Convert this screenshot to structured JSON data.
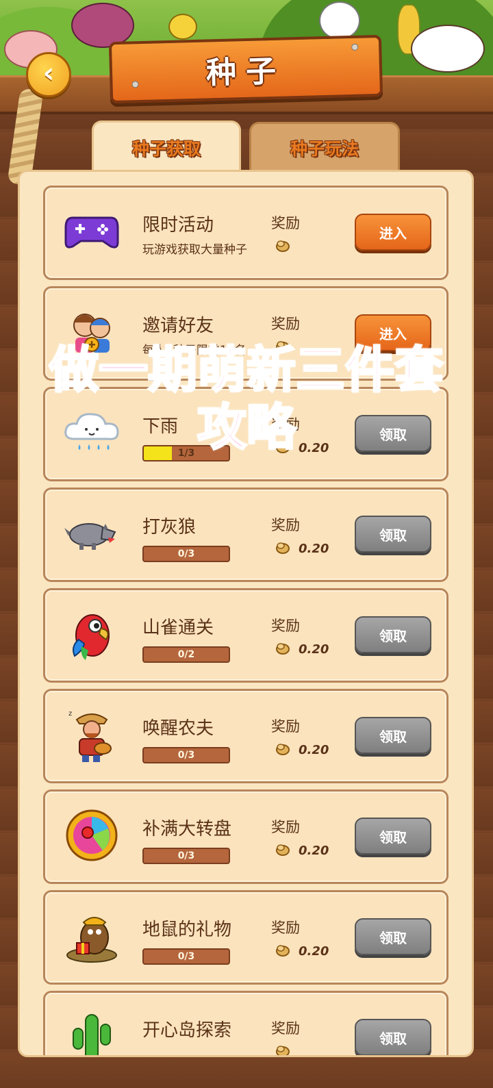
{
  "header": {
    "title": "种子",
    "back_icon": "chevron-left-icon"
  },
  "tabs": [
    {
      "label": "种子获取",
      "active": true
    },
    {
      "label": "种子玩法",
      "active": false
    }
  ],
  "overlay": {
    "line1": "做一期萌新三件套",
    "line2": "攻略"
  },
  "tasks": [
    {
      "name": "限时活动",
      "desc": "玩游戏获取大量种子",
      "reward_label": "奖励",
      "amount": "",
      "progress": "",
      "button": "进入",
      "icon": "gamepad-icon"
    },
    {
      "name": "邀请好友",
      "desc": "每人2种子限前10名",
      "reward_label": "奖励",
      "amount": "",
      "progress": "",
      "button": "进入",
      "icon": "friends-icon"
    },
    {
      "name": "下雨",
      "desc": "",
      "reward_label": "奖励",
      "amount": "0.20",
      "progress": "1/3",
      "progress_value": 0.33,
      "button": "领取",
      "icon": "rain-cloud-icon"
    },
    {
      "name": "打灰狼",
      "desc": "",
      "reward_label": "奖励",
      "amount": "0.20",
      "progress": "0/3",
      "progress_value": 0,
      "button": "领取",
      "icon": "wolf-icon"
    },
    {
      "name": "山雀通关",
      "desc": "",
      "reward_label": "奖励",
      "amount": "0.20",
      "progress": "0/2",
      "progress_value": 0,
      "button": "领取",
      "icon": "parrot-icon"
    },
    {
      "name": "唤醒农夫",
      "desc": "",
      "reward_label": "奖励",
      "amount": "0.20",
      "progress": "0/3",
      "progress_value": 0,
      "button": "领取",
      "icon": "farmer-icon"
    },
    {
      "name": "补满大转盘",
      "desc": "",
      "reward_label": "奖励",
      "amount": "0.20",
      "progress": "0/3",
      "progress_value": 0,
      "button": "领取",
      "icon": "wheel-icon"
    },
    {
      "name": "地鼠的礼物",
      "desc": "",
      "reward_label": "奖励",
      "amount": "0.20",
      "progress": "0/3",
      "progress_value": 0,
      "button": "领取",
      "icon": "mole-gift-icon"
    },
    {
      "name": "开心岛探索",
      "desc": "",
      "reward_label": "奖励",
      "amount": "",
      "progress": "",
      "button": "领取",
      "icon": "cactus-icon"
    }
  ]
}
